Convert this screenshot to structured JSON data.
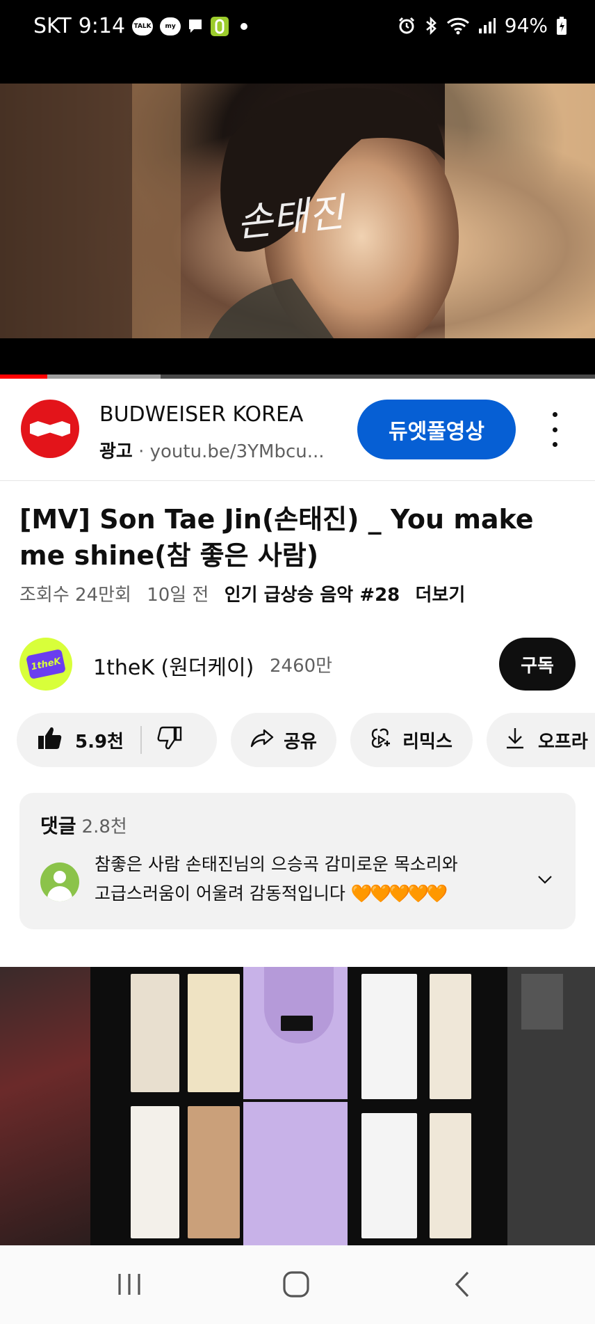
{
  "status_bar": {
    "carrier": "SKT",
    "time": "9:14",
    "battery": "94%"
  },
  "video": {
    "overlay_text": "손태진",
    "progress_played": 0.08,
    "progress_buffered": 0.27
  },
  "ad": {
    "advertiser": "BUDWEISER KOREA",
    "label": "광고",
    "separator": "·",
    "url": "youtu.be/3YMbcu...",
    "cta": "듀엣풀영상",
    "brand_color": "#e3141a"
  },
  "video_info": {
    "title": "[MV] Son Tae Jin(손태진) _ You make me shine(참 좋은 사람)",
    "views": "조회수 24만회",
    "age": "10일 전",
    "trending": "인기 급상승 음악 #28",
    "more": "더보기"
  },
  "channel": {
    "name": "1theK (원더케이)",
    "subscribers": "2460만",
    "subscribe_label": "구독",
    "avatar_text": "1theK"
  },
  "actions": {
    "like_count": "5.9천",
    "share": "공유",
    "remix": "리믹스",
    "offline": "오프라"
  },
  "comments": {
    "heading": "댓글",
    "count": "2.8천",
    "top_comment_line1": "참좋은 사람  손태진님의  으승곡  감미로운 목소리와",
    "top_comment_line2": "고급스러움이 어울려  감동적입니다",
    "hearts": "🧡🧡🧡🧡🧡"
  },
  "colors": {
    "accent_blue": "#065fd4",
    "progress_red": "#ff0000"
  }
}
